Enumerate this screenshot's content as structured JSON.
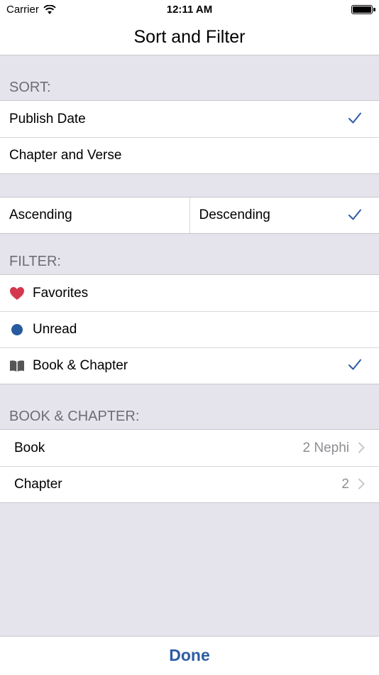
{
  "status_bar": {
    "carrier": "Carrier",
    "time": "12:11 AM"
  },
  "nav": {
    "title": "Sort and Filter"
  },
  "sort": {
    "header": "SORT:",
    "options": [
      {
        "label": "Publish Date",
        "checked": true
      },
      {
        "label": "Chapter and Verse",
        "checked": false
      }
    ]
  },
  "order": {
    "ascending": "Ascending",
    "descending": "Descending",
    "selected": "descending"
  },
  "filter": {
    "header": "FILTER:",
    "options": [
      {
        "label": "Favorites",
        "icon": "heart-icon",
        "checked": false
      },
      {
        "label": "Unread",
        "icon": "dot-icon",
        "checked": false
      },
      {
        "label": "Book & Chapter",
        "icon": "book-icon",
        "checked": true
      }
    ]
  },
  "book_chapter": {
    "header": "BOOK & CHAPTER:",
    "book_label": "Book",
    "book_value": "2 Nephi",
    "chapter_label": "Chapter",
    "chapter_value": "2"
  },
  "toolbar": {
    "done_label": "Done"
  },
  "colors": {
    "accent": "#2c5ca3",
    "heart": "#d4384f",
    "unread_dot": "#285aa0",
    "background": "#e5e4ec"
  }
}
